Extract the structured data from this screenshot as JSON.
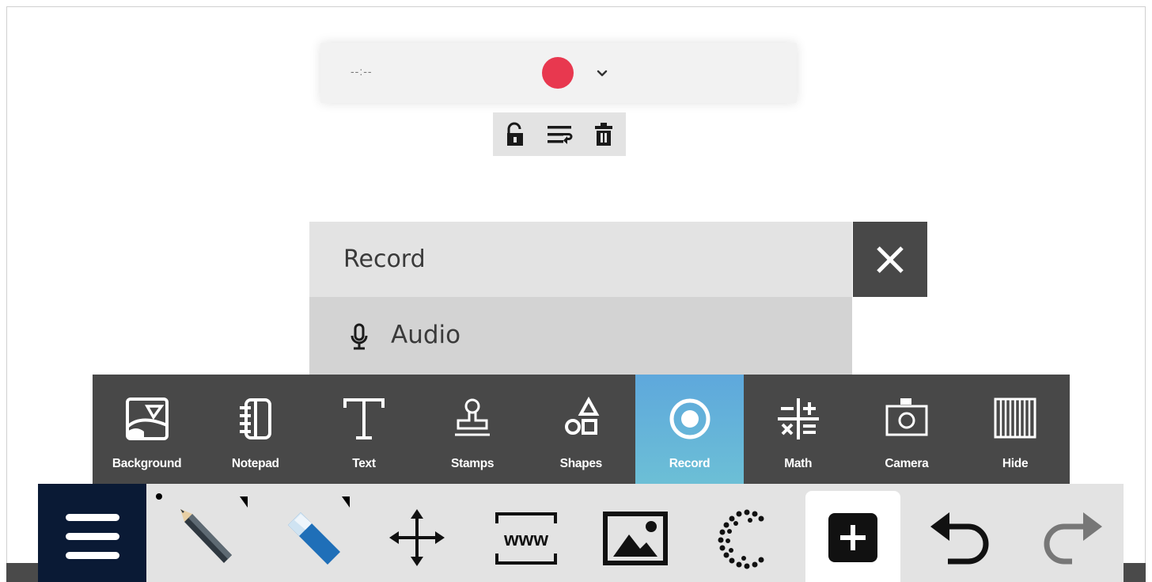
{
  "recorder": {
    "time": "--:--",
    "record_color": "#e8384f",
    "tools": [
      "unlock-icon",
      "wrap-text-icon",
      "trash-icon"
    ]
  },
  "record_panel": {
    "title": "Record",
    "items": [
      {
        "label": "Audio",
        "icon": "microphone-icon"
      }
    ]
  },
  "tools_bar": {
    "active": "Record",
    "active_color": "#64b4d8",
    "items": [
      {
        "label": "Background",
        "icon": "background-icon"
      },
      {
        "label": "Notepad",
        "icon": "notepad-icon"
      },
      {
        "label": "Text",
        "icon": "text-icon"
      },
      {
        "label": "Stamps",
        "icon": "stamp-icon"
      },
      {
        "label": "Shapes",
        "icon": "shapes-icon"
      },
      {
        "label": "Record",
        "icon": "record-icon"
      },
      {
        "label": "Math",
        "icon": "math-icon"
      },
      {
        "label": "Camera",
        "icon": "camera-icon"
      },
      {
        "label": "Hide",
        "icon": "hide-icon"
      }
    ]
  },
  "main_bar": {
    "items": [
      "menu-icon",
      "pencil-icon",
      "eraser-icon",
      "move-icon",
      "www-icon",
      "image-icon",
      "lasso-icon",
      "add-icon",
      "undo-icon",
      "redo-icon"
    ]
  }
}
